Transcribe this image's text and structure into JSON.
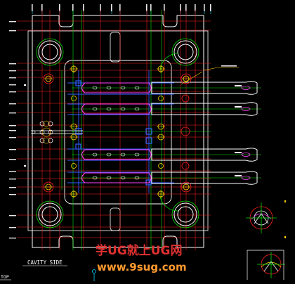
{
  "view_label": "CAVITY SIDE",
  "top_label": "TOP",
  "watermark": {
    "title": "学UG就上UG网",
    "url": "www.9sug.com"
  },
  "colors": {
    "background": "#000000",
    "outline": "#ffffff",
    "centerline": "#ff2020",
    "construction": "#00e000",
    "runner": "#ff40ff",
    "cooling": "#3060ff",
    "screw": "#ffd000",
    "dimension": "#00d8ff"
  },
  "icons": [
    "screw-icon",
    "guide-pin-icon",
    "section-detail-icon"
  ]
}
